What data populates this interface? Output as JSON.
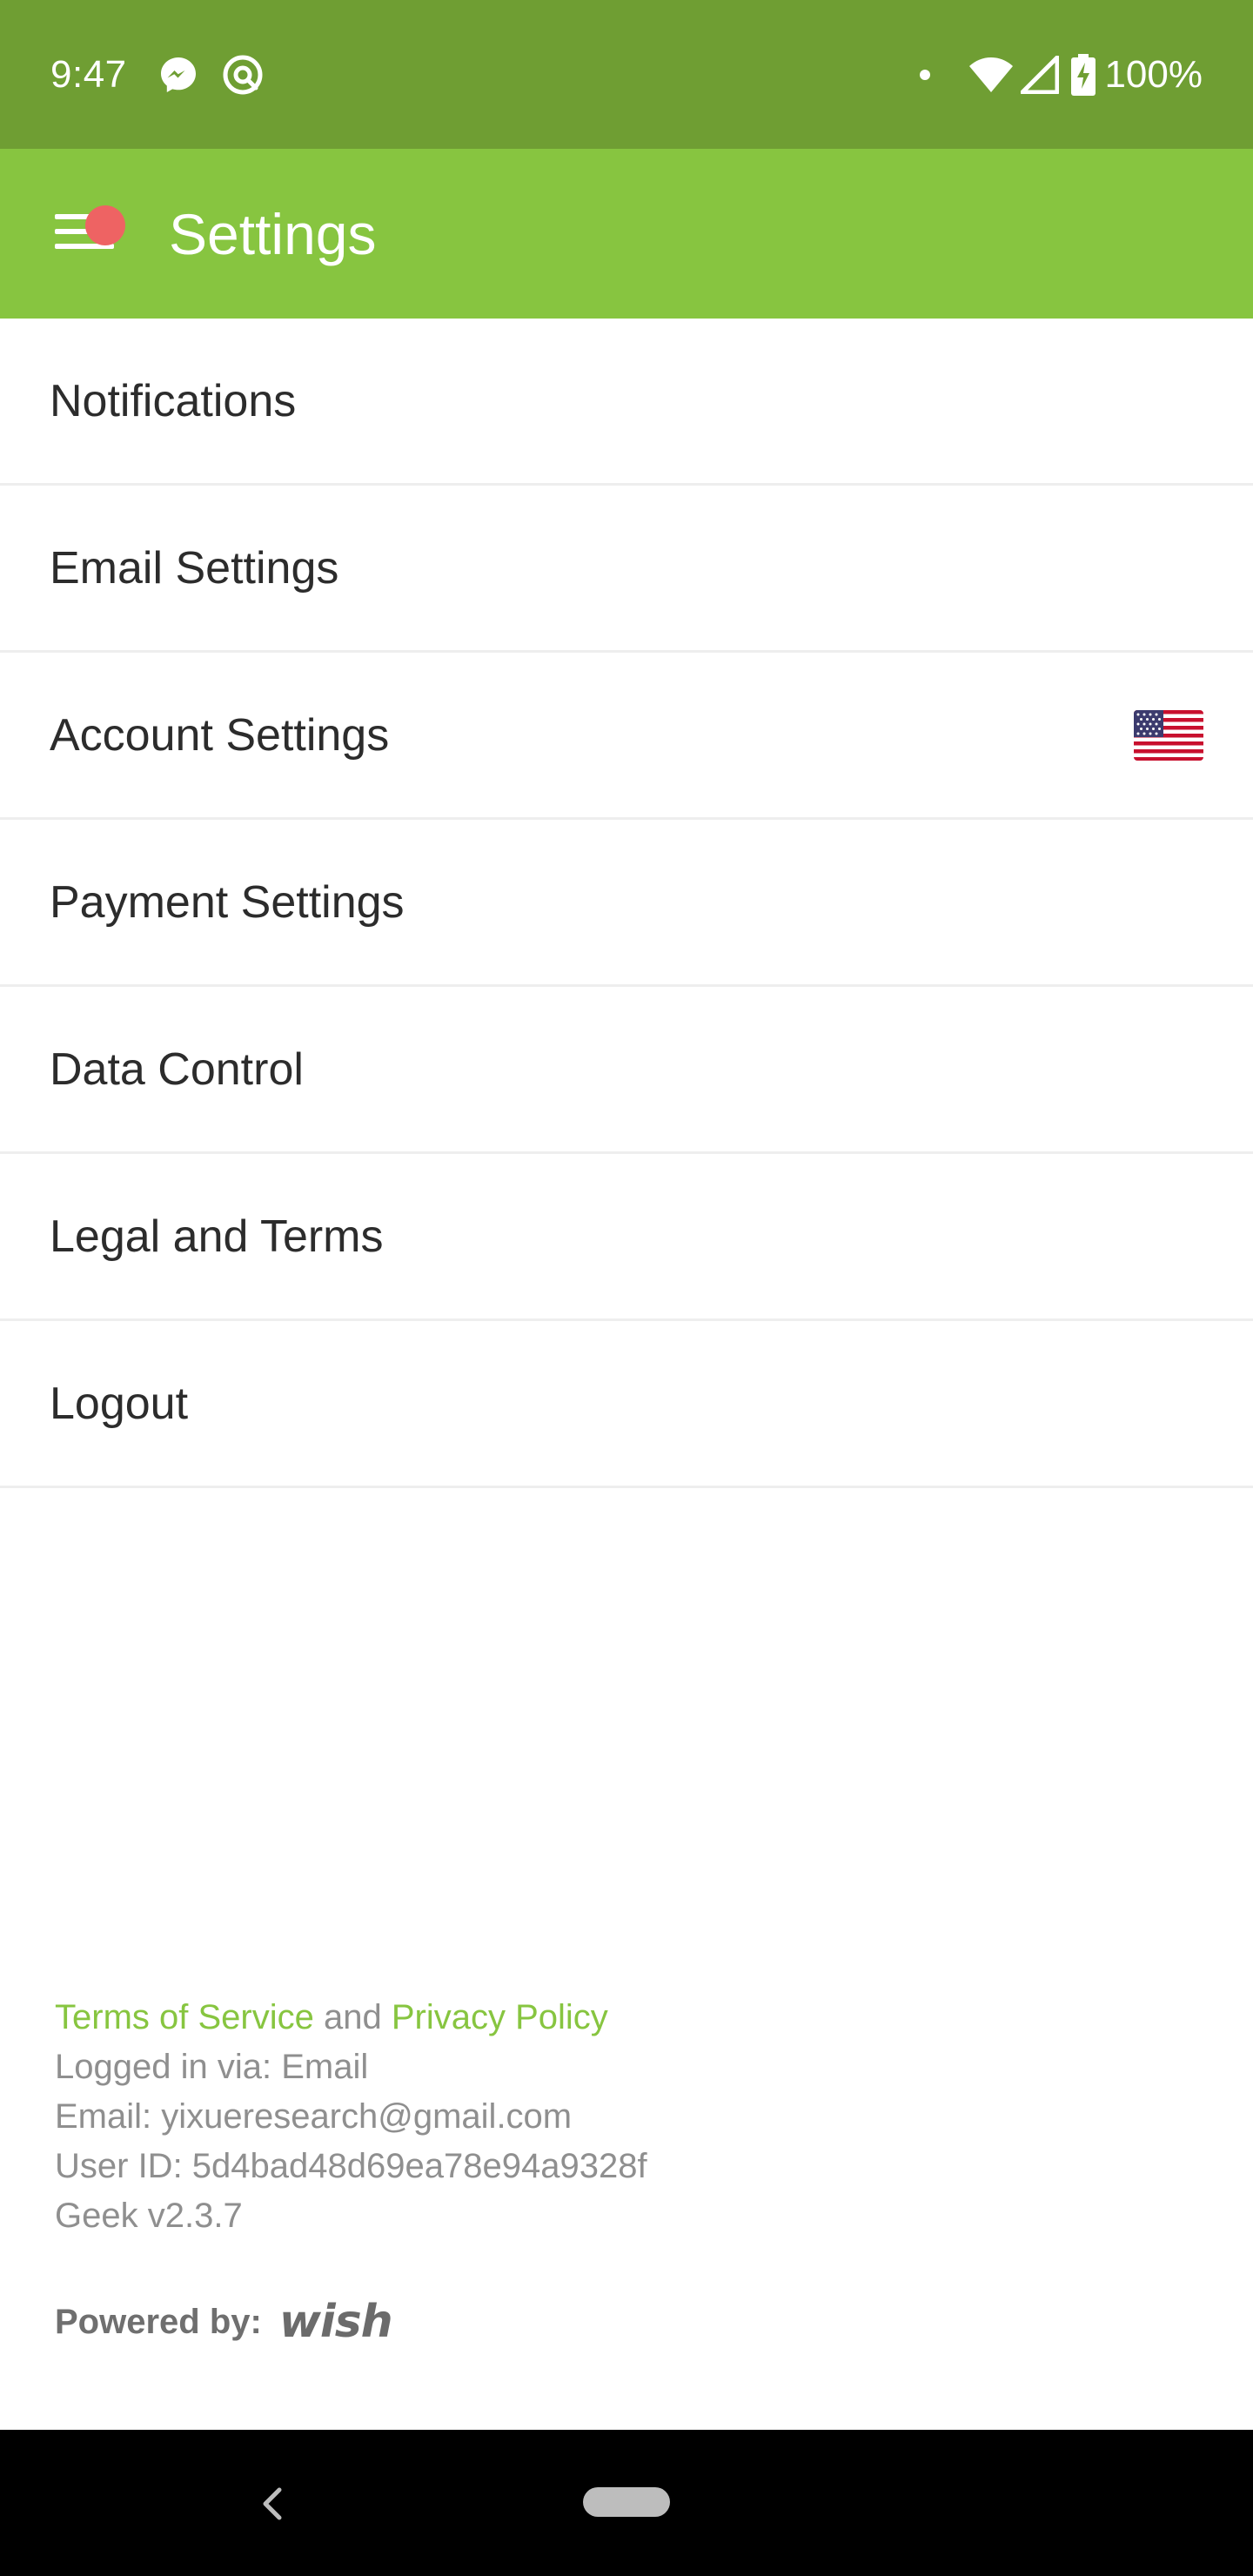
{
  "status_bar": {
    "time": "9:47",
    "icons_left": [
      "messenger-icon",
      "at-sign-icon"
    ],
    "icons_right": [
      "wifi-icon",
      "signal-icon",
      "battery-charging-icon"
    ],
    "battery": "100%"
  },
  "app_bar": {
    "title": "Settings",
    "menu_icon": "hamburger-menu-icon",
    "badge_color": "#ee6363",
    "background_color": "#87c540"
  },
  "settings": {
    "items": [
      {
        "label": "Notifications"
      },
      {
        "label": "Email Settings"
      },
      {
        "label": "Account Settings",
        "icon": "us-flag-icon"
      },
      {
        "label": "Payment Settings"
      },
      {
        "label": "Data Control"
      },
      {
        "label": "Legal and Terms"
      },
      {
        "label": "Logout"
      }
    ]
  },
  "footer": {
    "terms_link": "Terms of Service",
    "and_text": "and",
    "privacy_link": "Privacy Policy",
    "logged_in": "Logged in via: Email",
    "email": "Email: yixueresearch@gmail.com",
    "user_id": "User ID: 5d4bad48d69ea78e94a9328f",
    "version": "Geek v2.3.7",
    "powered_by": "Powered by:",
    "brand": "wish",
    "link_color": "#87c540"
  },
  "nav_bar": {
    "back_icon": "back-chevron-icon",
    "home_icon": "home-pill-icon"
  }
}
